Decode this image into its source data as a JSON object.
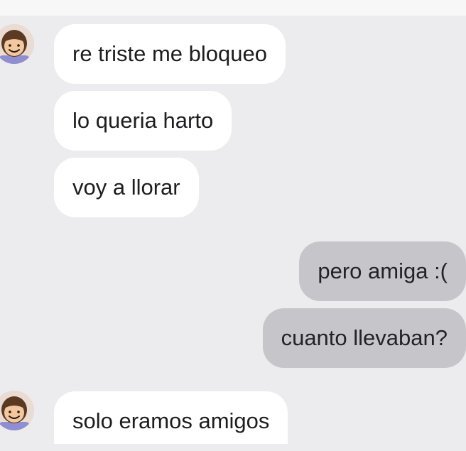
{
  "conversation": {
    "messages": [
      {
        "sender": "contact",
        "text": "re triste me bloqueo"
      },
      {
        "sender": "contact",
        "text": "lo queria harto"
      },
      {
        "sender": "contact",
        "text": "voy a llorar"
      },
      {
        "sender": "me",
        "text": "pero amiga :("
      },
      {
        "sender": "me",
        "text": "cuanto llevaban?"
      },
      {
        "sender": "contact",
        "text": "solo eramos amigos"
      }
    ]
  },
  "colors": {
    "background": "#ececee",
    "incoming_bubble": "#ffffff",
    "outgoing_bubble": "#c5c5ca",
    "text": "#1d1d1f"
  },
  "icons": {
    "contact_avatar": "avatar-character-icon"
  }
}
